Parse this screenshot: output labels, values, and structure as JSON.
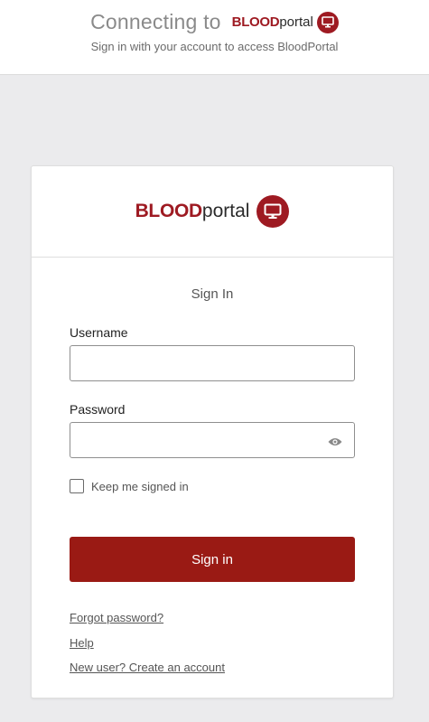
{
  "header": {
    "connecting_text": "Connecting to",
    "brand_strong": "BLOOD",
    "brand_light": "portal",
    "subtitle": "Sign in with your account to access BloodPortal"
  },
  "card": {
    "brand_strong": "BLOOD",
    "brand_light": "portal",
    "title": "Sign In",
    "username_label": "Username",
    "username_value": "",
    "password_label": "Password",
    "password_value": "",
    "keep_signed_in_label": "Keep me signed in",
    "keep_signed_in_checked": false,
    "signin_label": "Sign in",
    "links": {
      "forgot": "Forgot password?",
      "help": "Help",
      "register": "New user? Create an account"
    }
  },
  "colors": {
    "brand": "#9e1a22",
    "button": "#9a1a14",
    "background": "#ebebed"
  },
  "icons": {
    "logo": "monitor-icon",
    "password_toggle": "eye-icon"
  }
}
